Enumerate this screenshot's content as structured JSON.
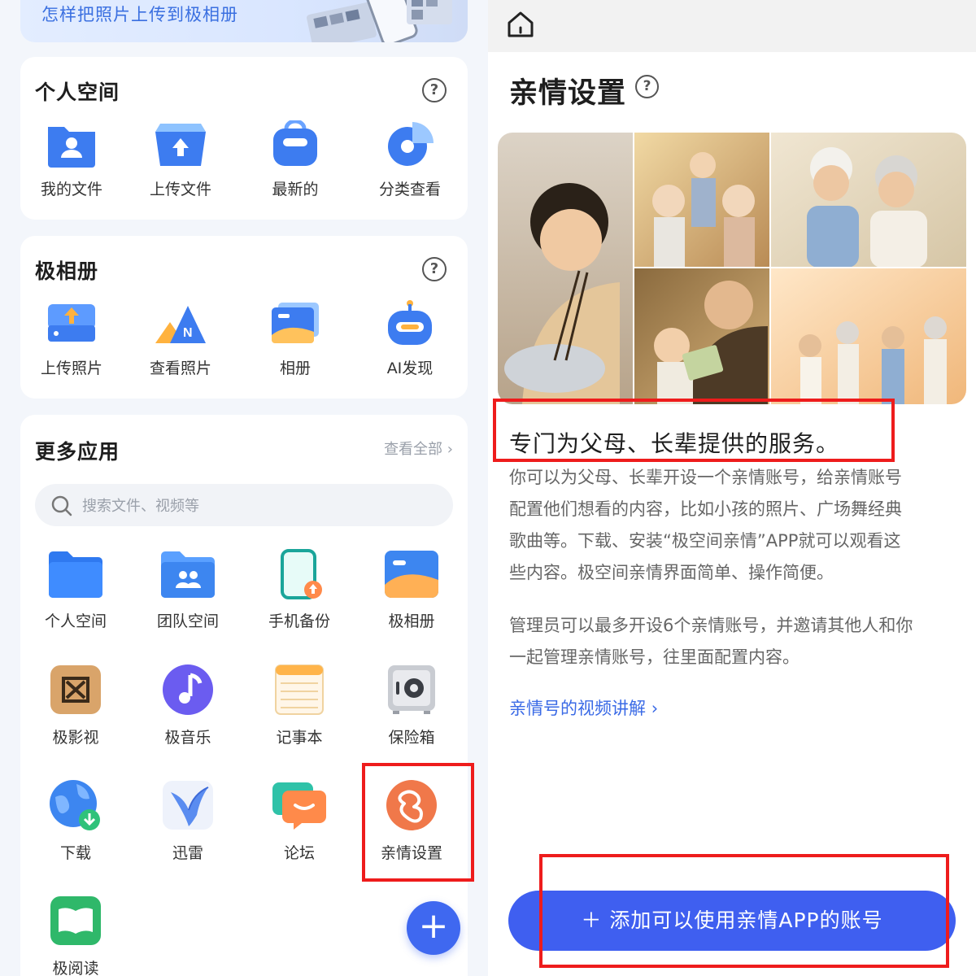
{
  "left": {
    "banner_text": "怎样把照片上传到极相册",
    "personal_space": {
      "title": "个人空间",
      "items": [
        {
          "label": "我的文件",
          "icon": "person-folder-icon"
        },
        {
          "label": "上传文件",
          "icon": "upload-box-icon"
        },
        {
          "label": "最新的",
          "icon": "backpack-icon"
        },
        {
          "label": "分类查看",
          "icon": "pie-chart-icon"
        }
      ]
    },
    "album": {
      "title": "极相册",
      "items": [
        {
          "label": "上传照片",
          "icon": "upload-drive-icon"
        },
        {
          "label": "查看照片",
          "icon": "mountain-icon"
        },
        {
          "label": "相册",
          "icon": "photo-stack-icon"
        },
        {
          "label": "AI发现",
          "icon": "robot-icon"
        }
      ]
    },
    "more_apps": {
      "title": "更多应用",
      "view_all": "查看全部",
      "search_placeholder": "搜索文件、视频等",
      "apps": [
        {
          "label": "个人空间",
          "icon": "folder-icon"
        },
        {
          "label": "团队空间",
          "icon": "team-folder-icon"
        },
        {
          "label": "手机备份",
          "icon": "phone-backup-icon"
        },
        {
          "label": "极相册",
          "icon": "photo-icon"
        },
        {
          "label": "极影视",
          "icon": "film-icon"
        },
        {
          "label": "极音乐",
          "icon": "music-icon"
        },
        {
          "label": "记事本",
          "icon": "notepad-icon"
        },
        {
          "label": "保险箱",
          "icon": "safe-icon"
        },
        {
          "label": "下载",
          "icon": "download-globe-icon"
        },
        {
          "label": "迅雷",
          "icon": "thunder-bird-icon"
        },
        {
          "label": "论坛",
          "icon": "forum-icon"
        },
        {
          "label": "亲情设置",
          "icon": "family-icon"
        },
        {
          "label": "极阅读",
          "icon": "book-icon"
        }
      ]
    }
  },
  "right": {
    "title": "亲情设置",
    "subhead": "专门为父母、长辈提供的服务。",
    "paragraph1_lines": [
      "你可以为父母、长辈开设一个亲情账号，给亲情账号",
      "配置他们想看的内容，比如小孩的照片、广场舞经典",
      "歌曲等。下载、安装“极空间亲情”APP就可以观看这",
      "些内容。极空间亲情界面简单、操作简便。"
    ],
    "paragraph2_lines": [
      "管理员可以最多开设6个亲情账号，并邀请其他人和你",
      "一起管理亲情账号，往里面配置内容。"
    ],
    "video_link": "亲情号的视频讲解",
    "cta_button": "＋ 添加可以使用亲情APP的账号"
  },
  "colors": {
    "accent_blue": "#3f5ff0",
    "link_blue": "#3a6ae6",
    "highlight_red": "#ee1c1c",
    "family_orange": "#f0784a"
  }
}
